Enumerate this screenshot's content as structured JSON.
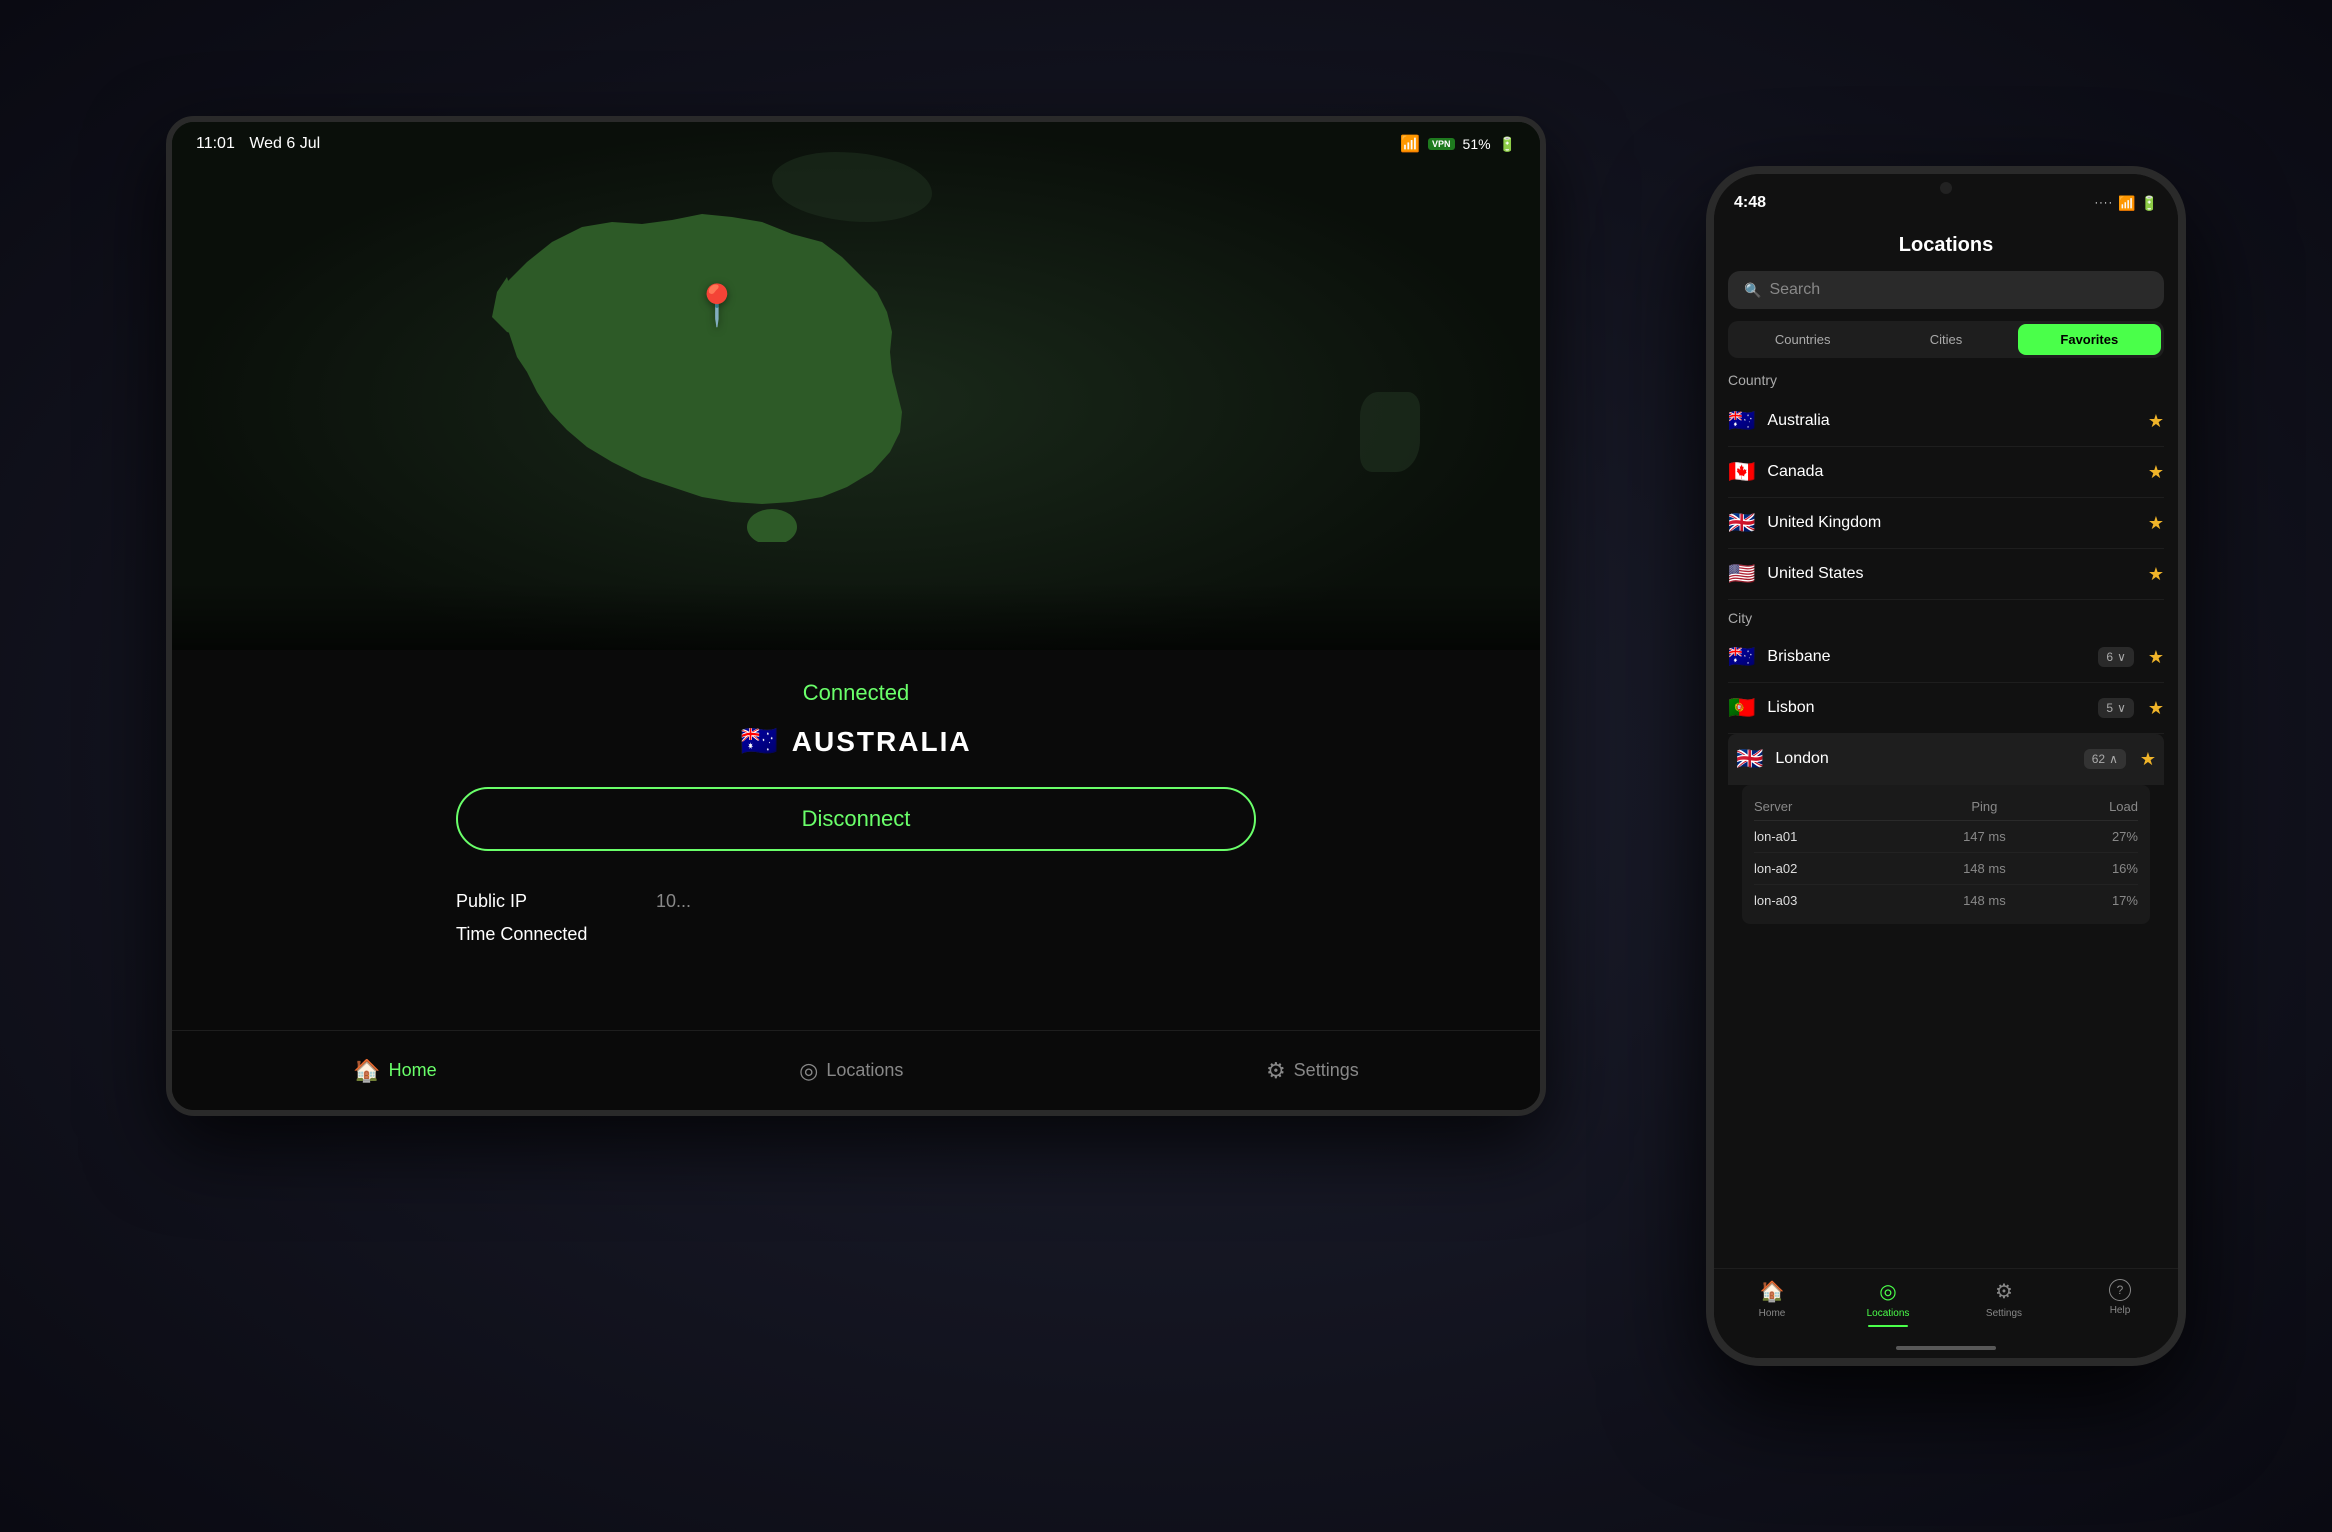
{
  "scene": {
    "bg_color": "#0a0a12"
  },
  "tablet": {
    "statusbar": {
      "time": "11:01",
      "date": "Wed 6 Jul",
      "right": "51%"
    },
    "map": {
      "pin_emoji": "📍",
      "connected_label": "Connected",
      "country_flag": "🇦🇺",
      "country_name": "AUSTRALIA"
    },
    "disconnect_button": "Disconnect",
    "info": {
      "public_ip_label": "Public IP",
      "public_ip_value": "10...",
      "time_connected_label": "Time Connected",
      "time_connected_value": ""
    },
    "nav": {
      "home_label": "Home",
      "locations_label": "Locations",
      "settings_label": "Settings"
    }
  },
  "phone": {
    "statusbar": {
      "time": "4:48",
      "signal": "●●●● ",
      "wifi": "WiFi",
      "battery": "■"
    },
    "header": {
      "title": "Locations"
    },
    "search": {
      "placeholder": "Search"
    },
    "tabs": [
      {
        "label": "Countries",
        "active": false
      },
      {
        "label": "Cities",
        "active": false
      },
      {
        "label": "Favorites",
        "active": true
      }
    ],
    "country_section_label": "Country",
    "countries": [
      {
        "flag": "🇦🇺",
        "name": "Australia",
        "starred": true
      },
      {
        "flag": "🇨🇦",
        "name": "Canada",
        "starred": true
      },
      {
        "flag": "🇬🇧",
        "name": "United Kingdom",
        "starred": true
      },
      {
        "flag": "🇺🇸",
        "name": "United States",
        "starred": true
      }
    ],
    "city_section_label": "City",
    "cities": [
      {
        "flag": "🇦🇺",
        "name": "Brisbane",
        "count": 6,
        "starred": true
      },
      {
        "flag": "🇵🇹",
        "name": "Lisbon",
        "count": 5,
        "starred": true
      },
      {
        "flag": "🇬🇧",
        "name": "London",
        "count": 62,
        "starred": true,
        "expanded": true
      }
    ],
    "servers": {
      "headers": {
        "server": "Server",
        "ping": "Ping",
        "load": "Load"
      },
      "rows": [
        {
          "server": "lon-a01",
          "ping": "147 ms",
          "load": "27%"
        },
        {
          "server": "lon-a02",
          "ping": "148 ms",
          "load": "16%"
        },
        {
          "server": "lon-a03",
          "ping": "148 ms",
          "load": "17%"
        }
      ]
    },
    "nav": [
      {
        "icon": "🏠",
        "label": "Home",
        "active": false
      },
      {
        "icon": "◎",
        "label": "Locations",
        "active": true
      },
      {
        "icon": "⚙",
        "label": "Settings",
        "active": false
      },
      {
        "icon": "?",
        "label": "Help",
        "active": false
      }
    ]
  }
}
